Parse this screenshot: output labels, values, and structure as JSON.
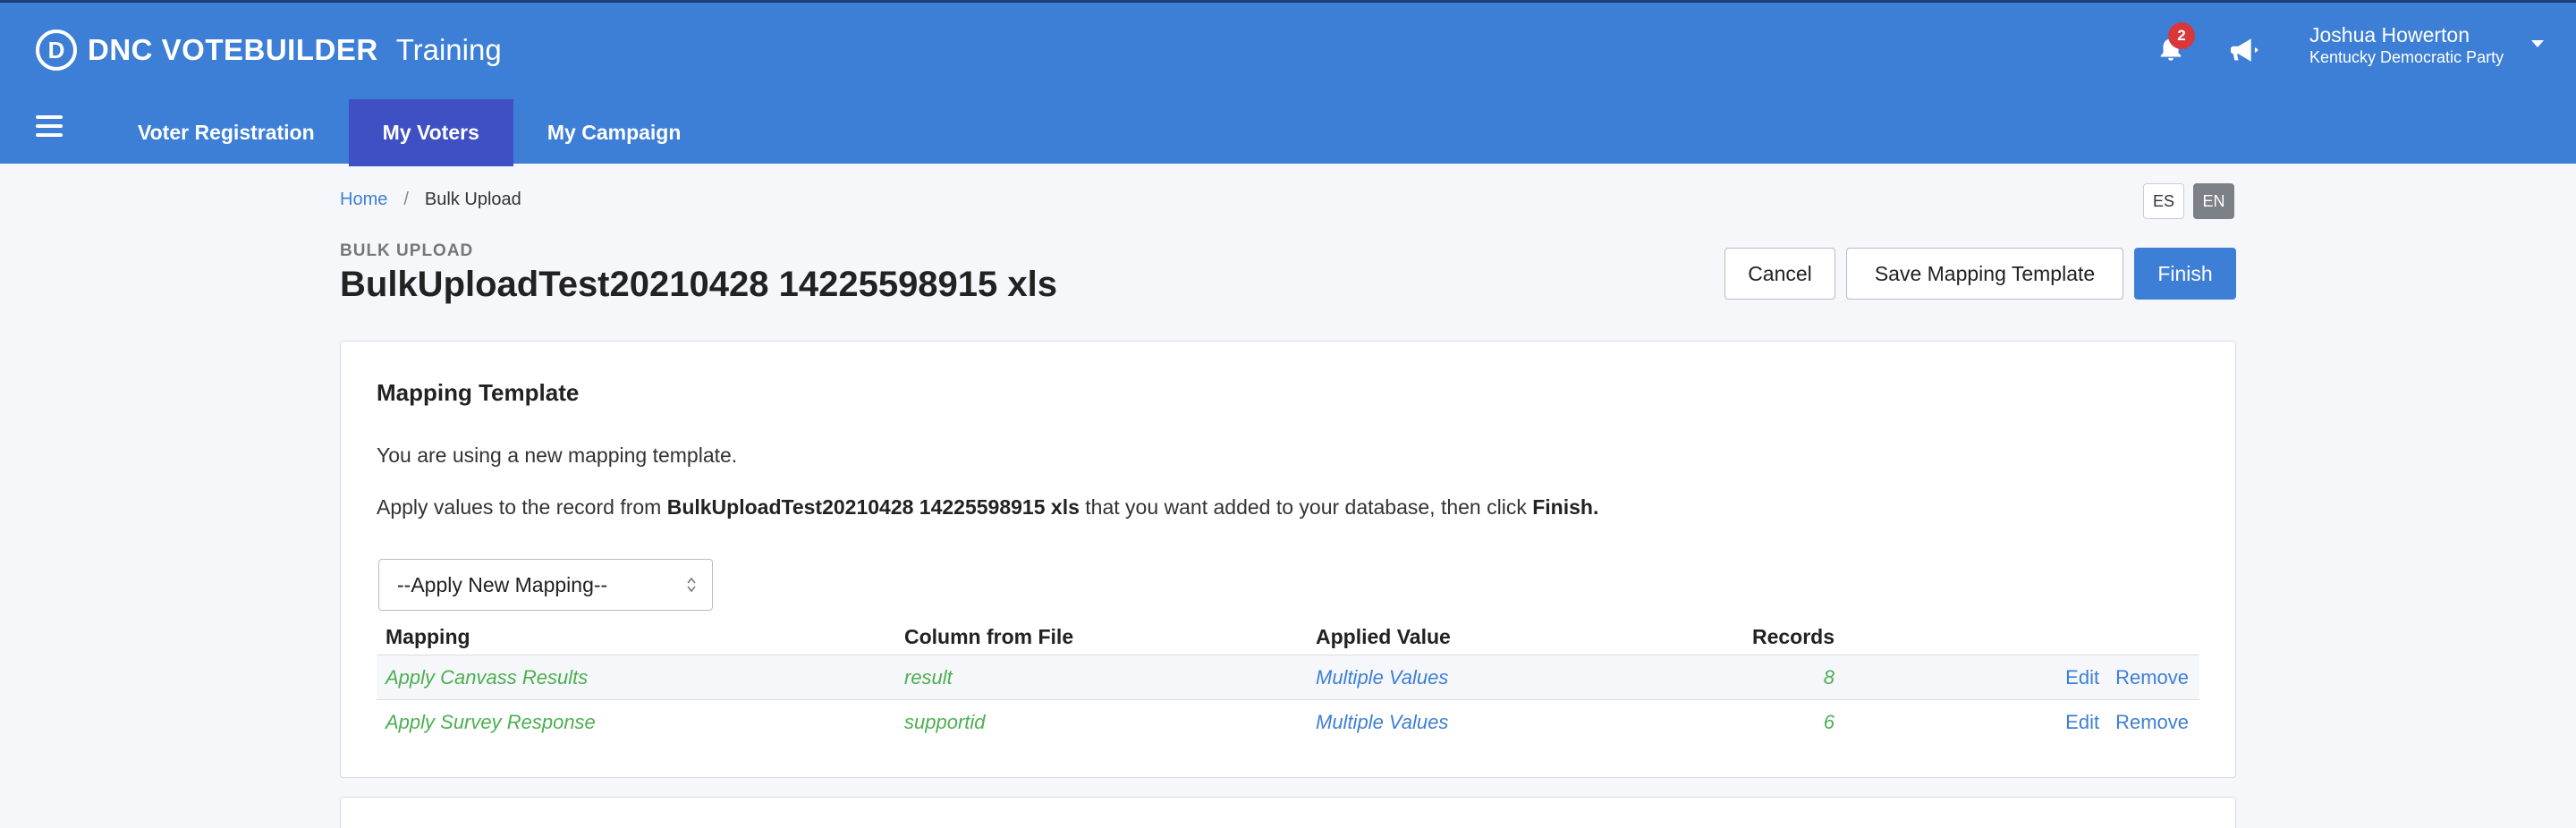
{
  "header": {
    "brand_logo": "D",
    "brand_name": "DNC VOTEBUILDER",
    "environment": "Training",
    "notification_count": "2",
    "user_name": "Joshua Howerton",
    "user_org": "Kentucky Democratic Party",
    "nav": [
      "Voter Registration",
      "My Voters",
      "My Campaign"
    ],
    "active_nav": "My Voters"
  },
  "breadcrumb": {
    "home": "Home",
    "separator": "/",
    "current": "Bulk Upload"
  },
  "languages": {
    "es": "ES",
    "en": "EN",
    "active": "EN"
  },
  "page": {
    "eyebrow": "BULK UPLOAD",
    "title": "BulkUploadTest20210428 14225598915 xls"
  },
  "actions": {
    "cancel": "Cancel",
    "save_template": "Save Mapping Template",
    "finish": "Finish"
  },
  "mapping": {
    "title": "Mapping Template",
    "line1": "You are using a new mapping template.",
    "line2_prefix": "Apply values to the record from ",
    "line2_file": "BulkUploadTest20210428 14225598915 xls",
    "line2_middle": " that you want added to your database, then click ",
    "line2_finish": "Finish.",
    "select_value": "--Apply New Mapping--",
    "columns": [
      "Mapping",
      "Column from File",
      "Applied Value",
      "Records"
    ],
    "rows": [
      {
        "mapping": "Apply Canvass Results",
        "column": "result",
        "value": "Multiple Values",
        "records": "8",
        "edit": "Edit",
        "remove": "Remove"
      },
      {
        "mapping": "Apply Survey Response",
        "column": "supportid",
        "value": "Multiple Values",
        "records": "6",
        "edit": "Edit",
        "remove": "Remove"
      }
    ]
  },
  "colors": {
    "header": "#3d7fd6",
    "active_nav": "#3f4fc4",
    "badge": "#d9383a",
    "link": "#3d7fd6",
    "mapped_text": "#4caf50"
  },
  "icons": [
    "bell-icon",
    "megaphone-icon",
    "hamburger-icon",
    "caret-down-icon",
    "select-caret-icon"
  ]
}
